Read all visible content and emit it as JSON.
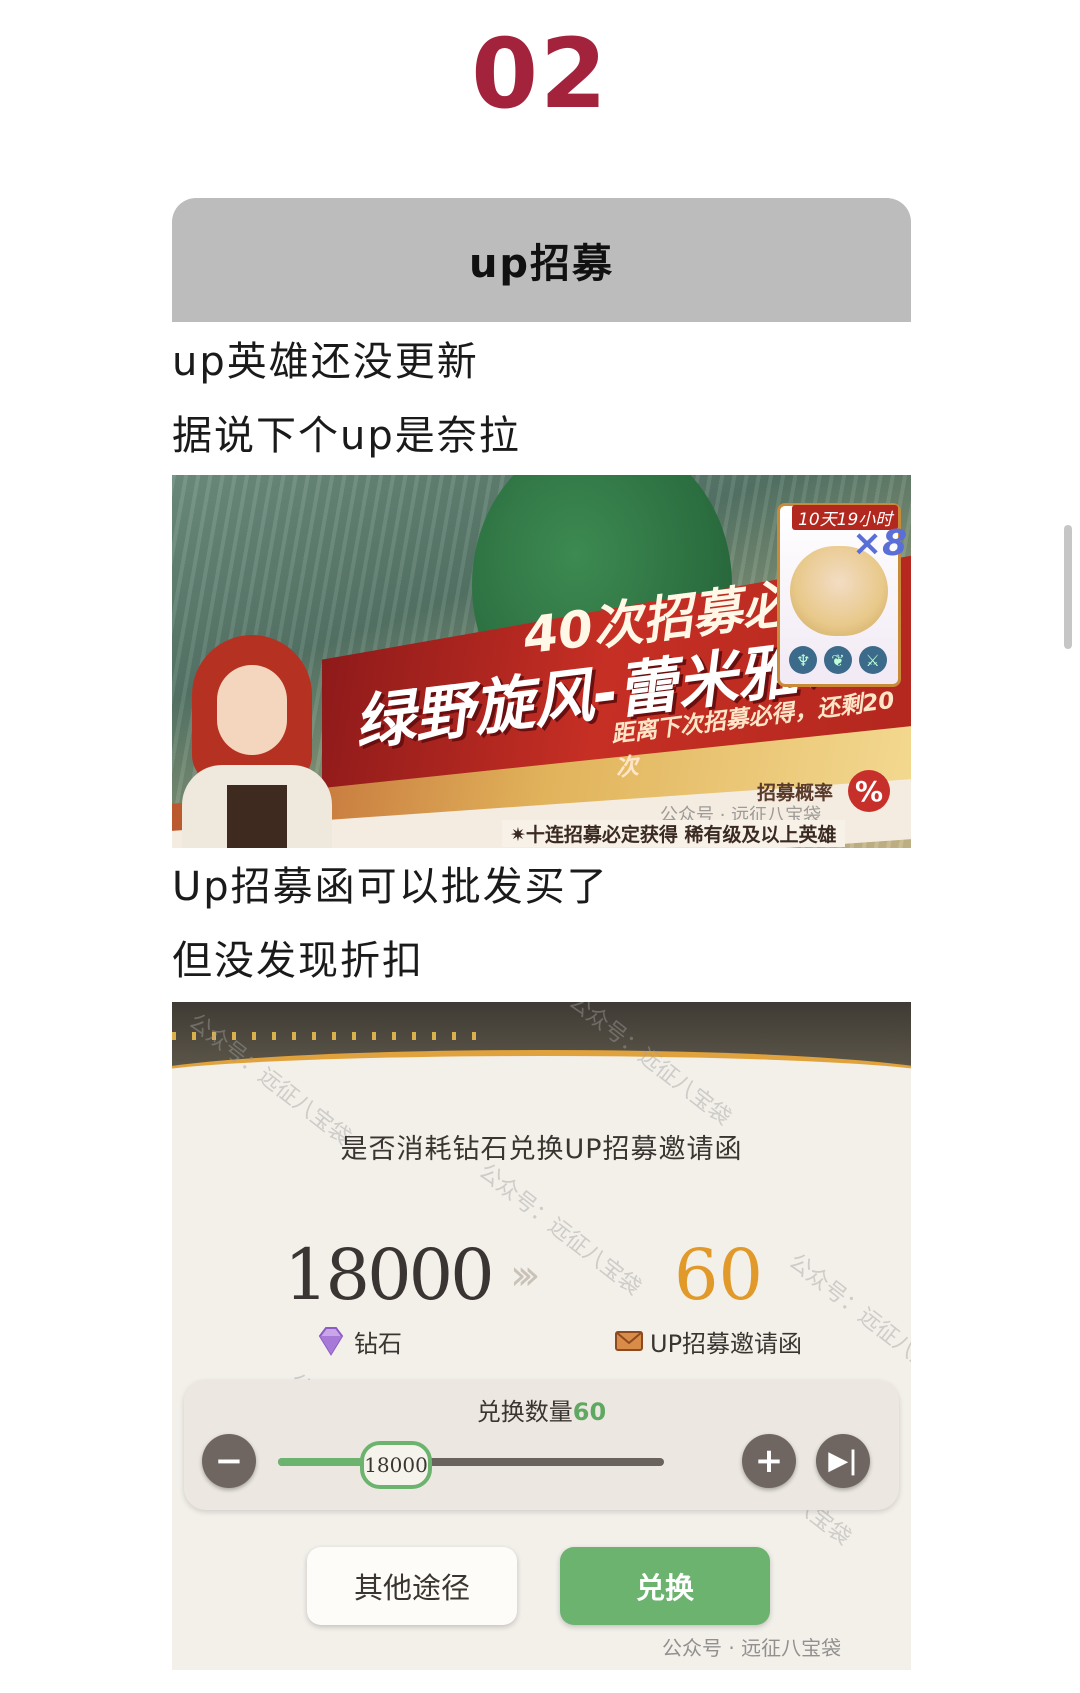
{
  "section_number": "02",
  "header": {
    "title": "up招募"
  },
  "paragraphs": {
    "p1": "up英雄还没更新",
    "p2": "据说下个up是奈拉",
    "p3": "Up招募函可以批发买了",
    "p4": "但没发现折扣"
  },
  "banner": {
    "guarantee_text": "40次招募必得",
    "hero_text": "绿野旋风-蕾米雅×8",
    "remaining_text": "距离下次招募必得，还剩20次",
    "timer_text": "10天19小时",
    "card_multiplier": "×8",
    "rate_label": "招募概率",
    "rate_icon": "%",
    "footer_text": "✷十连招募必定获得  稀有级及以上英雄",
    "watermark": "公众号 · 远征八宝袋"
  },
  "dialog": {
    "question": "是否消耗钻石兑换UP招募邀请函",
    "cost_value": "18000",
    "cost_label": "钻石",
    "gain_value": "60",
    "gain_label": "UP招募邀请函",
    "quantity_label": "兑换数量",
    "quantity_value": "60",
    "slider_value_label": "18000",
    "slider_fraction": 0.3,
    "minus_label": "−",
    "plus_label": "+",
    "max_label": "▶|",
    "other_button": "其他途径",
    "exchange_button": "兑换",
    "watermark": "公众号 · 远征八宝袋",
    "bg_watermark": "公众号：远征八宝袋"
  },
  "colors": {
    "accent": "#a4233c",
    "green": "#6cb36f",
    "gold": "#e19a2a"
  }
}
